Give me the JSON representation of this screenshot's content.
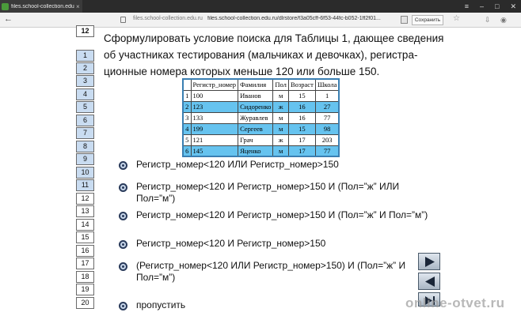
{
  "browser": {
    "tab_title": "files.school-collection.edu",
    "tab_close": "×",
    "back": "←",
    "url_domain": "files.school-collection.edu.ru",
    "url_path": "files.school-collection.edu.ru/dlrstore/f3a05cff-6f53-44fc-b052-1ff2f01...",
    "save_label": "Сохранить"
  },
  "question_nav": [
    "12",
    "1",
    "2",
    "3",
    "4",
    "5",
    "6",
    "7",
    "8",
    "9",
    "10",
    "11",
    "12",
    "13",
    "14",
    "15",
    "16",
    "17",
    "18",
    "19",
    "20"
  ],
  "question": {
    "text": "Сформулировать условие поиска для Таблицы 1, дающее сведения об участниках тестирования (мальчиках и девочках), регистра-ционные номера которых меньше 120 или больше 150."
  },
  "table": {
    "headers": [
      "",
      "Регистр_номер",
      "Фамилия",
      "Пол",
      "Возраст",
      "Школа"
    ],
    "rows": [
      [
        "1",
        "100",
        "Иванов",
        "м",
        "15",
        "1"
      ],
      [
        "2",
        "123",
        "Сидоренко",
        "ж",
        "16",
        "27"
      ],
      [
        "3",
        "133",
        "Журавлев",
        "м",
        "16",
        "77"
      ],
      [
        "4",
        "199",
        "Сергеев",
        "м",
        "15",
        "98"
      ],
      [
        "5",
        "121",
        "Грач",
        "ж",
        "17",
        "203"
      ],
      [
        "6",
        "145",
        "Яценко",
        "м",
        "17",
        "77"
      ]
    ]
  },
  "options": [
    "Регистр_номер<120 ИЛИ Регистр_номер>150",
    "Регистр_номер<120 И Регистр_номер>150 И (Пол=”ж” ИЛИ Пол=”м”)",
    "Регистр_номер<120 И Регистр_номер>150 И (Пол=”ж” И Пол=”м”)",
    "Регистр_номер<120 И Регистр_номер>150",
    "(Регистр_номер<120 ИЛИ Регистр_номер>150) И (Пол=”ж” И Пол=”м”)",
    "пропустить"
  ],
  "watermark": "online-otvet.ru",
  "colors": {
    "table_blue": "#66c3ef",
    "nav_blue": "#c9dcf1",
    "table_border": "#3a7fb2"
  }
}
